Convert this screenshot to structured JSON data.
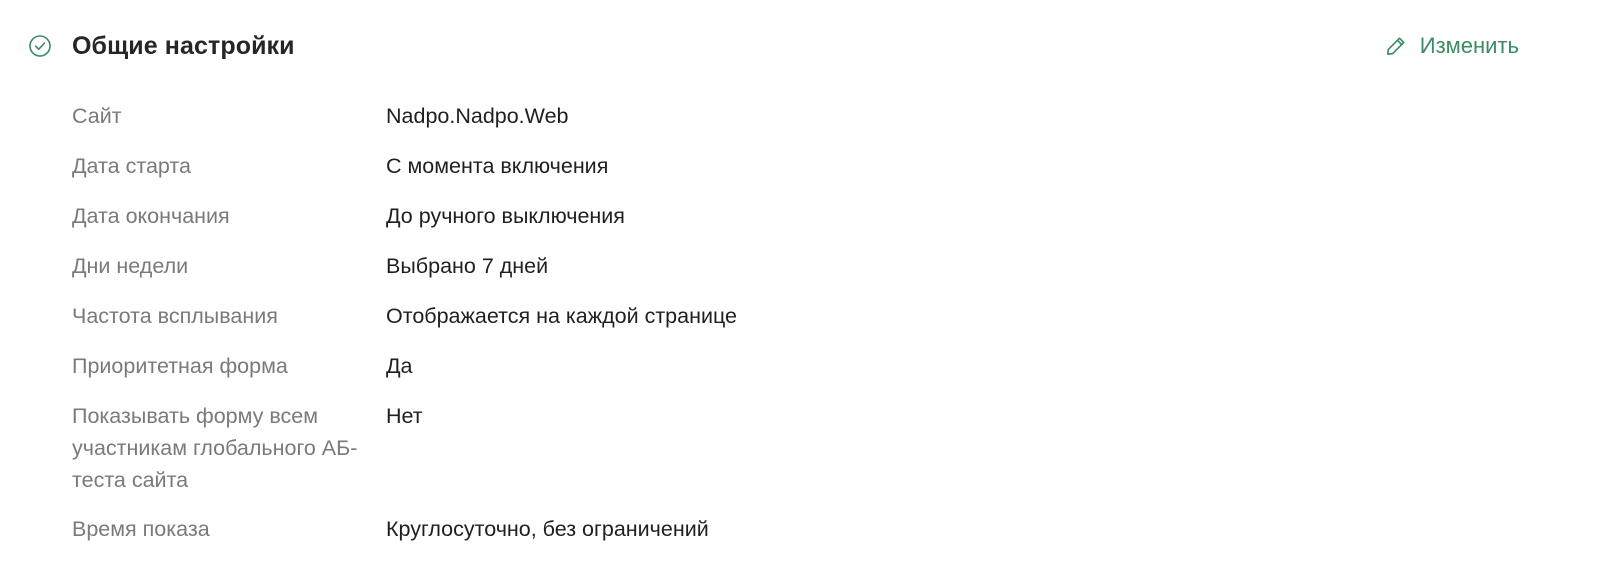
{
  "section": {
    "title": "Общие настройки",
    "status_icon": "check-circle-icon",
    "edit_label": "Изменить",
    "edit_icon": "pencil-icon",
    "accent_color": "#3d8a64"
  },
  "settings": [
    {
      "label": "Сайт",
      "value": "Nadpo.Nadpo.Web"
    },
    {
      "label": "Дата старта",
      "value": "С момента включения"
    },
    {
      "label": "Дата окончания",
      "value": "До ручного выключения"
    },
    {
      "label": "Дни недели",
      "value": "Выбрано 7 дней"
    },
    {
      "label": "Частота всплывания",
      "value": "Отображается на каждой странице"
    },
    {
      "label": "Приоритетная форма",
      "value": "Да"
    },
    {
      "label": "Показывать форму всем участникам глобального АБ-теста сайта",
      "value": "Нет"
    },
    {
      "label": "Время показа",
      "value": "Круглосуточно, без ограничений"
    }
  ]
}
